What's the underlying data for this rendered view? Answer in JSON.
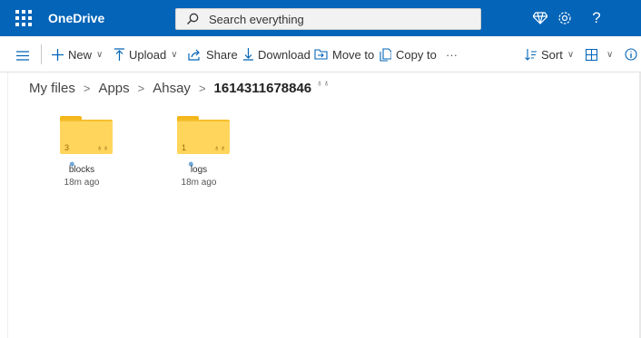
{
  "appbar": {
    "brand": "OneDrive",
    "search_placeholder": "Search everything"
  },
  "commands": {
    "new": "New",
    "upload": "Upload",
    "share": "Share",
    "download": "Download",
    "move_to": "Move to",
    "copy_to": "Copy to",
    "more": "···",
    "sort": "Sort"
  },
  "breadcrumb": {
    "items": [
      "My files",
      "Apps",
      "Ahsay"
    ],
    "current": "1614311678846"
  },
  "folders": [
    {
      "name": "blocks",
      "count": "3",
      "modified": "18m ago"
    },
    {
      "name": "logs",
      "count": "1",
      "modified": "18m ago"
    }
  ],
  "colors": {
    "appbar_bg": "#0364b8",
    "folder_fill": "#ffd55c",
    "folder_tab": "#f5b61a"
  }
}
